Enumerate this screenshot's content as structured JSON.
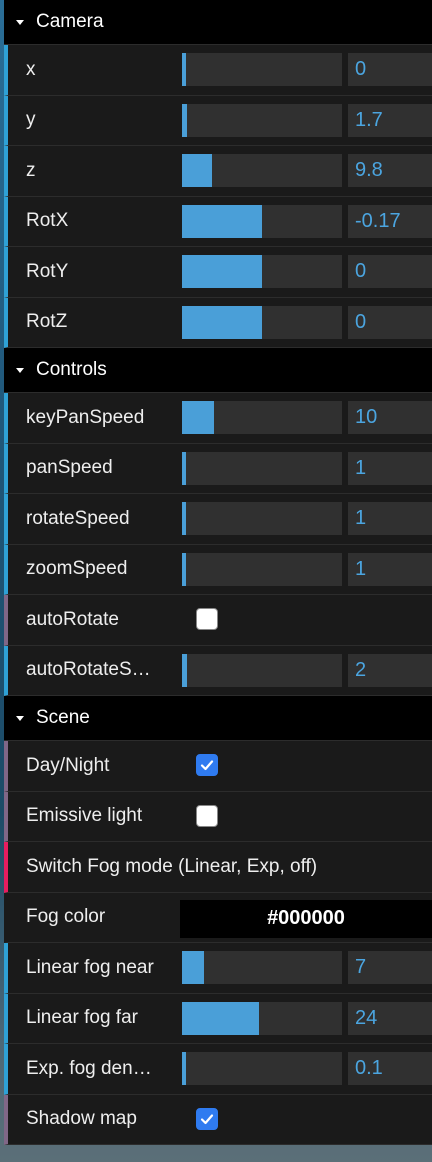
{
  "folders": [
    {
      "title": "Camera",
      "rows": [
        {
          "label": "x",
          "value": "0",
          "fill": 0.0
        },
        {
          "label": "y",
          "value": "1.7",
          "fill": 0.03
        },
        {
          "label": "z",
          "value": "9.8",
          "fill": 0.19
        },
        {
          "label": "RotX",
          "value": "-0.17",
          "fill": 0.5
        },
        {
          "label": "RotY",
          "value": "0",
          "fill": 0.5
        },
        {
          "label": "RotZ",
          "value": "0",
          "fill": 0.5
        }
      ]
    },
    {
      "title": "Controls",
      "rows": [
        {
          "label": "keyPanSpeed",
          "value": "10",
          "fill": 0.2
        },
        {
          "label": "panSpeed",
          "value": "1",
          "fill": 0.02
        },
        {
          "label": "rotateSpeed",
          "value": "1",
          "fill": 0.02
        },
        {
          "label": "zoomSpeed",
          "value": "1",
          "fill": 0.02
        },
        {
          "label": "autoRotate",
          "checked": false
        },
        {
          "label": "autoRotateSpe…",
          "value": "2",
          "fill": 0.03
        }
      ]
    },
    {
      "title": "Scene",
      "rows": [
        {
          "label": "Day/Night",
          "checked": true
        },
        {
          "label": "Emissive light",
          "checked": false
        },
        {
          "label": "Switch Fog mode (Linear, Exp, off)"
        },
        {
          "label": "Fog color",
          "color": "#000000"
        },
        {
          "label": "Linear fog near",
          "value": "7",
          "fill": 0.14
        },
        {
          "label": "Linear fog far",
          "value": "24",
          "fill": 0.48
        },
        {
          "label": "Exp. fog density",
          "value": "0.1",
          "fill": 0.02
        },
        {
          "label": "Shadow map",
          "checked": true
        }
      ]
    }
  ],
  "colors": {
    "slider_fill": "#4a9fd8",
    "number_text": "#4ba5e0",
    "checkbox_on": "#2f7bf0"
  }
}
